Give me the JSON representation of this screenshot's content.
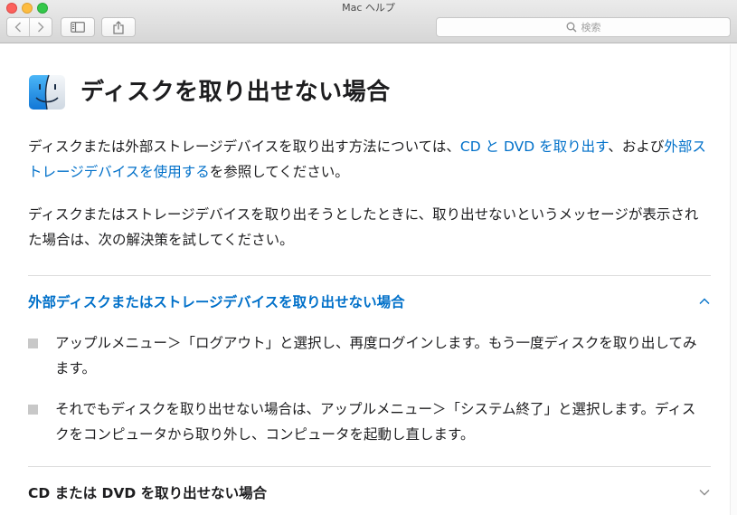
{
  "window": {
    "title": "Mac ヘルプ"
  },
  "toolbar": {
    "search_placeholder": "検索"
  },
  "article": {
    "title": "ディスクを取り出せない場合",
    "intro": {
      "text_before_link1": "ディスクまたは外部ストレージデバイスを取り出す方法については、",
      "link1": "CD と DVD を取り出す",
      "text_between": "、および",
      "link2": "外部ストレージデバイスを使用する",
      "text_after": "を参照してください。"
    },
    "paragraph2": "ディスクまたはストレージデバイスを取り出そうとしたときに、取り出せないというメッセージが表示された場合は、次の解決策を試してください。",
    "sections": [
      {
        "title": "外部ディスクまたはストレージデバイスを取り出せない場合",
        "expanded": true,
        "items": [
          "アップルメニュー＞「ログアウト」と選択し、再度ログインします。もう一度ディスクを取り出してみます。",
          "それでもディスクを取り出せない場合は、アップルメニュー＞「システム終了」と選択します。ディスクをコンピュータから取り外し、コンピュータを起動し直します。"
        ]
      },
      {
        "title": "CD または DVD を取り出せない場合",
        "expanded": false
      }
    ]
  },
  "colors": {
    "link": "#0070c9",
    "text": "#1d1d1f",
    "bullet": "#c8c8c8"
  }
}
